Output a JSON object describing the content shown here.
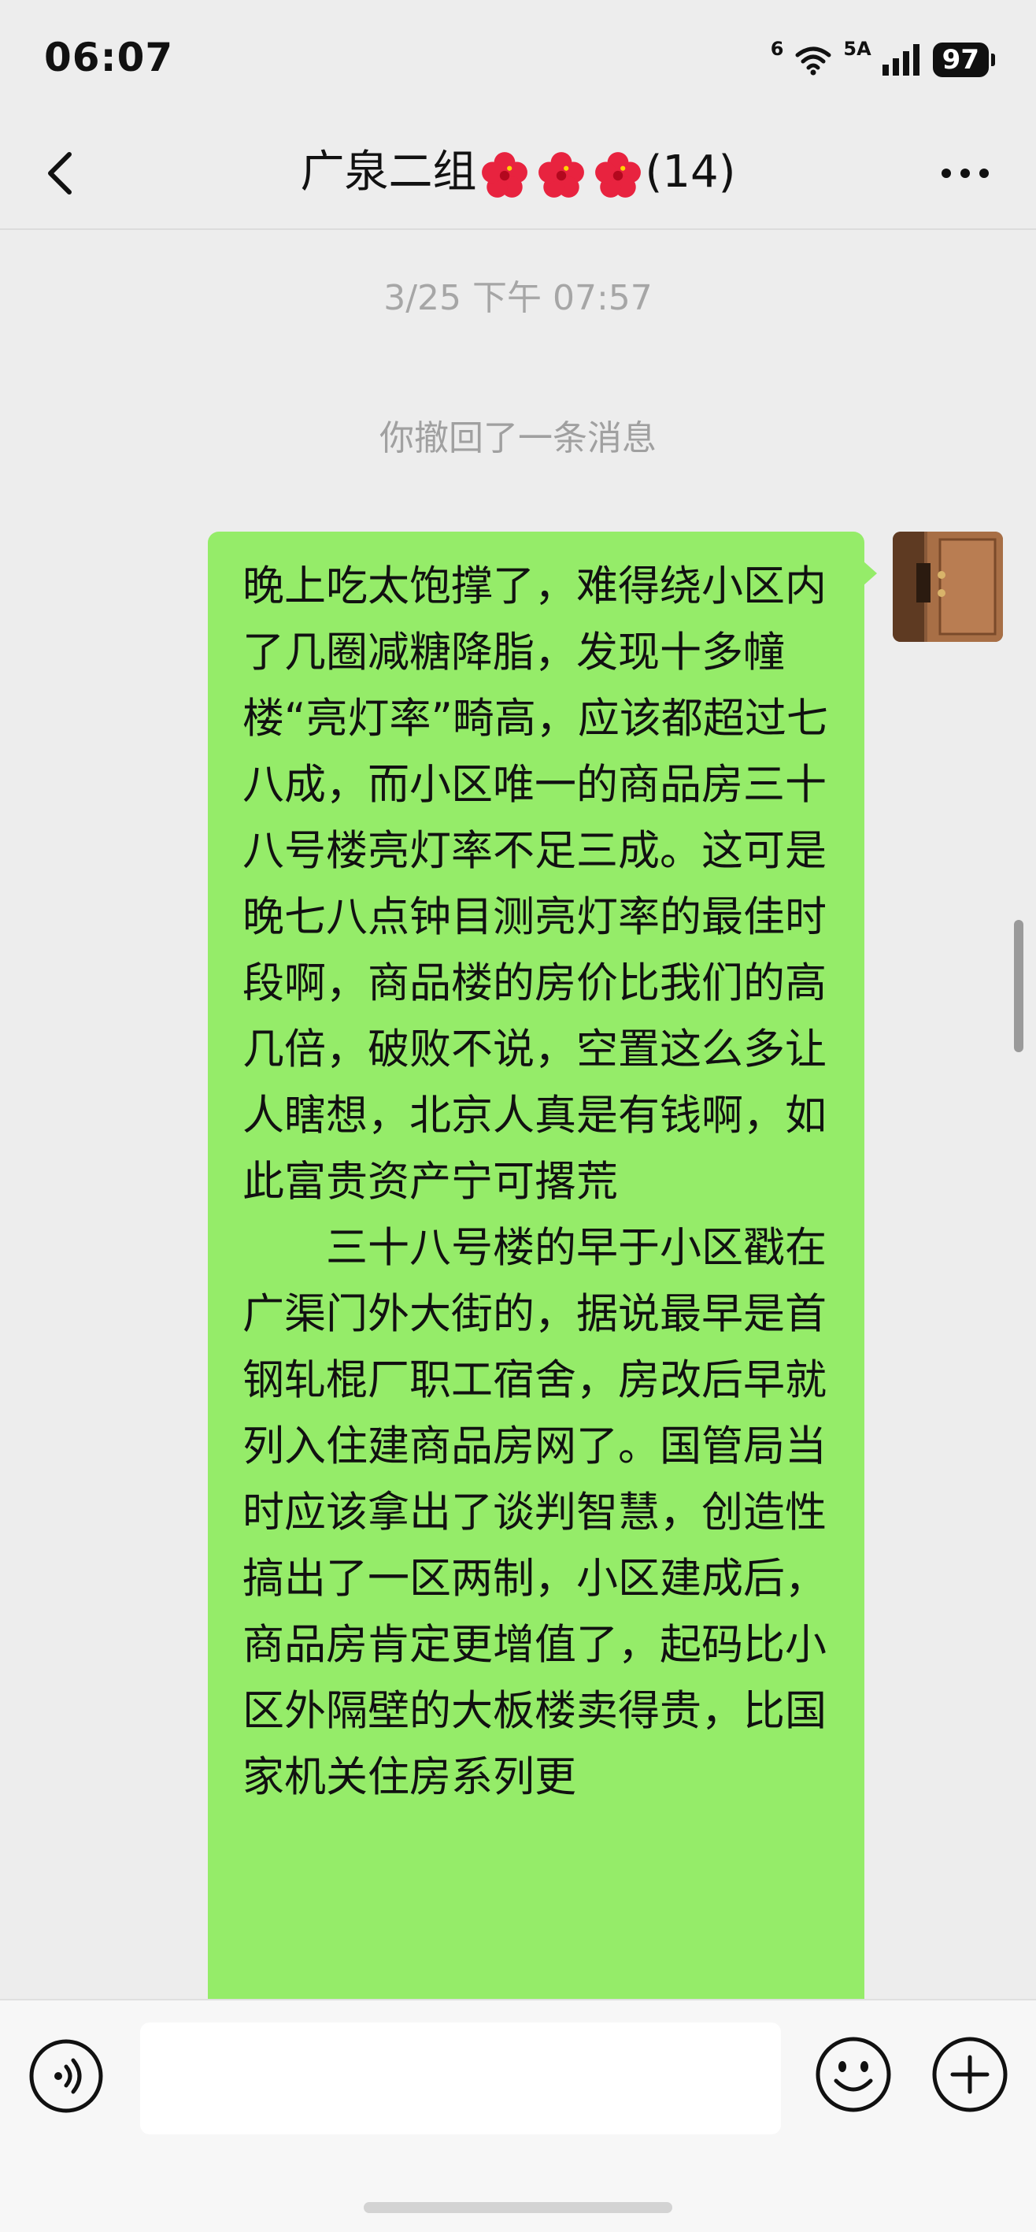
{
  "status_bar": {
    "time": "06:07",
    "wifi_label": "6",
    "signal_label": "5A",
    "battery": "97"
  },
  "header": {
    "title_prefix": "广泉二组",
    "title_suffix": "(14)",
    "flower_icon": "hibiscus-icon",
    "flower_color": "#e8233f"
  },
  "chat": {
    "timestamp": "3/25 下午 07:57",
    "system_message": "你撤回了一条消息",
    "message": {
      "sender": "self",
      "bubble_color": "#95ec69",
      "text": "晚上吃太饱撑了，难得绕小区内了几圈减糖降脂，发现十多幢楼“亮灯率”畸高，应该都超过七八成，而小区唯一的商品房三十八号楼亮灯率不足三成。这可是晚七八点钟目测亮灯率的最佳时段啊，商品楼的房价比我们的高几倍，破败不说，空置这么多让人瞎想，北京人真是有钱啊，如此富贵资产宁可撂荒\n　　三十八号楼的早于小区戳在广渠门外大街的，据说最早是首钢轧棍厂职工宿舍，房改后早就列入住建商品房网了。国管局当时应该拿出了谈判智慧，创造性搞出了一区两制，小区建成后，商品房肯定更增值了，起码比小区外隔壁的大板楼卖得贵，比国家机关住房系列更"
    }
  },
  "input_bar": {
    "voice_icon": "voice-icon",
    "emoji_icon": "emoji-icon",
    "plus_icon": "plus-icon",
    "input_value": ""
  }
}
